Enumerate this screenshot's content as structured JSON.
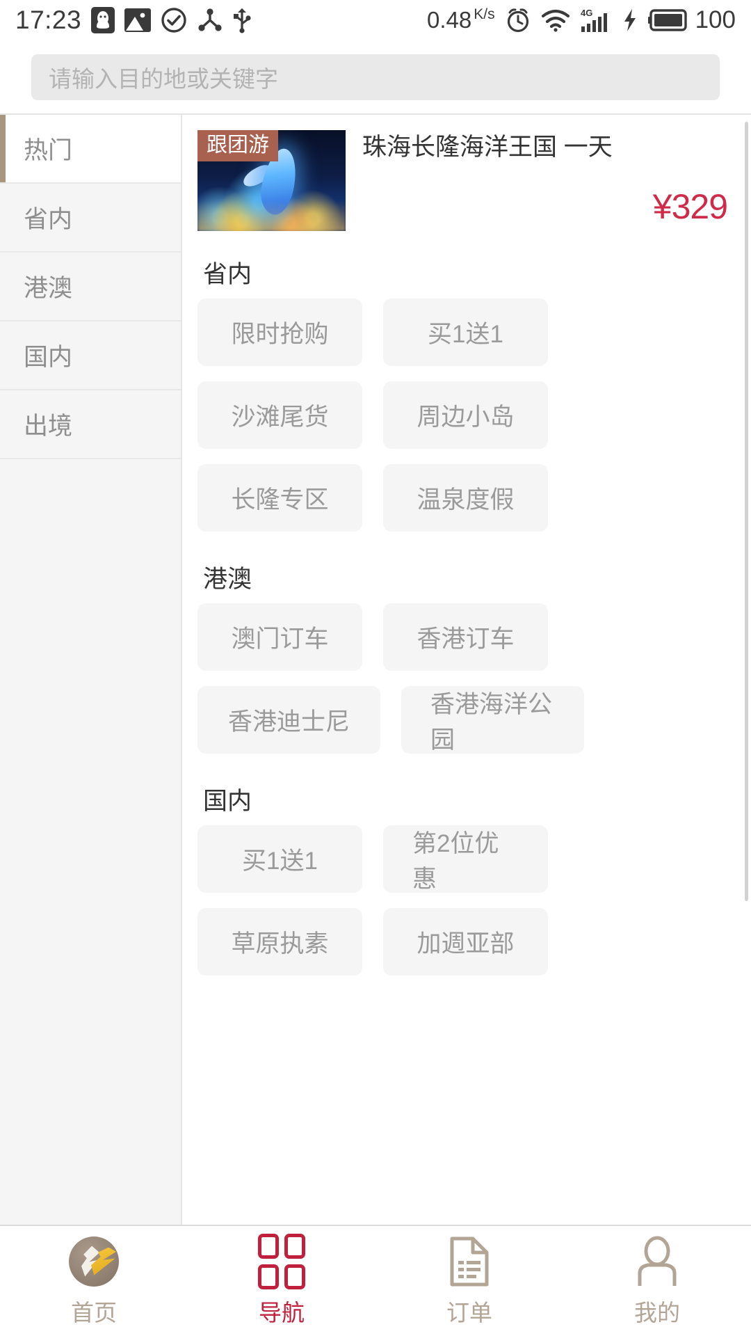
{
  "status_bar": {
    "time": "17:23",
    "left_icons": [
      "qq-penguin-icon",
      "image-icon",
      "check-circle-icon",
      "share-network-icon",
      "usb-icon"
    ],
    "net_speed": "0.48",
    "net_speed_unit_top": "K",
    "net_speed_unit_bottom": "s",
    "right_icons": [
      "alarm-clock-icon",
      "wifi-icon",
      "signal-4g-icon",
      "charging-bolt-icon",
      "battery-icon"
    ],
    "signal_label": "4G",
    "battery_percent": "100"
  },
  "search": {
    "placeholder": "请输入目的地或关键字"
  },
  "sidebar": {
    "items": [
      {
        "label": "热门",
        "active": true
      },
      {
        "label": "省内",
        "active": false
      },
      {
        "label": "港澳",
        "active": false
      },
      {
        "label": "国内",
        "active": false
      },
      {
        "label": "出境",
        "active": false
      }
    ]
  },
  "product": {
    "badge": "跟团游",
    "title": "珠海长隆海洋王国 一天",
    "price": "¥329",
    "image_alt": "dolphin-light-show-thumbnail"
  },
  "sections": [
    {
      "title": "省内",
      "chips": [
        {
          "label": "限时抢购",
          "size": "w4"
        },
        {
          "label": "买1送1",
          "size": "w4"
        },
        {
          "label": "沙滩尾货",
          "size": "w4"
        },
        {
          "label": "周边小岛",
          "size": "w4"
        },
        {
          "label": "长隆专区",
          "size": "w4"
        },
        {
          "label": "温泉度假",
          "size": "w4"
        }
      ]
    },
    {
      "title": "港澳",
      "chips": [
        {
          "label": "澳门订车",
          "size": "w4"
        },
        {
          "label": "香港订车",
          "size": "w4"
        },
        {
          "label": "香港迪士尼",
          "size": "w5"
        },
        {
          "label": "香港海洋公园",
          "size": "w5"
        }
      ]
    },
    {
      "title": "国内",
      "chips": [
        {
          "label": "买1送1",
          "size": "w4"
        },
        {
          "label": "第2位优惠",
          "size": "w4"
        },
        {
          "label": "草原执素",
          "size": "w4"
        },
        {
          "label": "加週亚部",
          "size": "w4"
        }
      ]
    }
  ],
  "bottom_nav": {
    "items": [
      {
        "label": "首页",
        "icon": "home-logo-icon",
        "active": false
      },
      {
        "label": "导航",
        "icon": "grid-navigation-icon",
        "active": true
      },
      {
        "label": "订单",
        "icon": "document-order-icon",
        "active": false
      },
      {
        "label": "我的",
        "icon": "person-profile-icon",
        "active": false
      }
    ]
  },
  "colors": {
    "accent_tan": "#a8967e",
    "active_red": "#c0203c",
    "price_red": "#cf2b49",
    "badge_brown": "#a8604f",
    "nav_inactive": "#b3a595"
  }
}
